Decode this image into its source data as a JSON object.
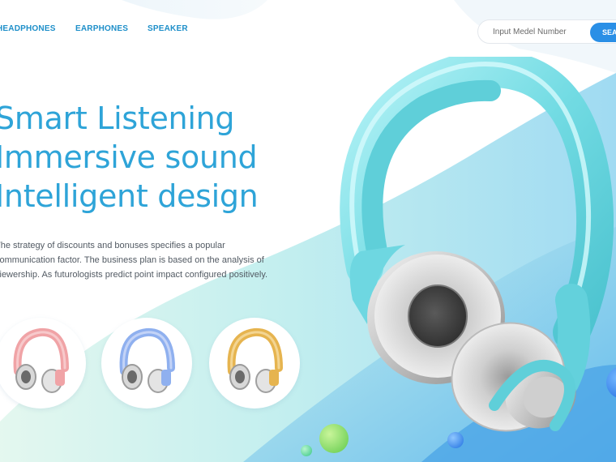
{
  "nav": {
    "items": [
      {
        "label": "HEADPHONES"
      },
      {
        "label": "EARPHONES"
      },
      {
        "label": "SPEAKER"
      }
    ]
  },
  "search": {
    "placeholder": "Input Medel Number",
    "button_label": "SEARCH"
  },
  "hero": {
    "lines": [
      "Smart Listening",
      "Immersive sound",
      "Intelligent design"
    ],
    "description": "The strategy of discounts and bonuses specifies a popular communication factor. The business plan is based on the analysis of viewership. As futurologists predict point impact configured positively."
  },
  "products": [
    {
      "icon": "headphones-pink-icon",
      "color": "#f0a3a6"
    },
    {
      "icon": "headphones-blue-icon",
      "color": "#8fb0ef"
    },
    {
      "icon": "headphones-gold-icon",
      "color": "#e6b44f"
    }
  ],
  "colors": {
    "accent": "#2ea4d8",
    "button": "#2a8fe6",
    "headphone_main": "#7fe0e8"
  }
}
